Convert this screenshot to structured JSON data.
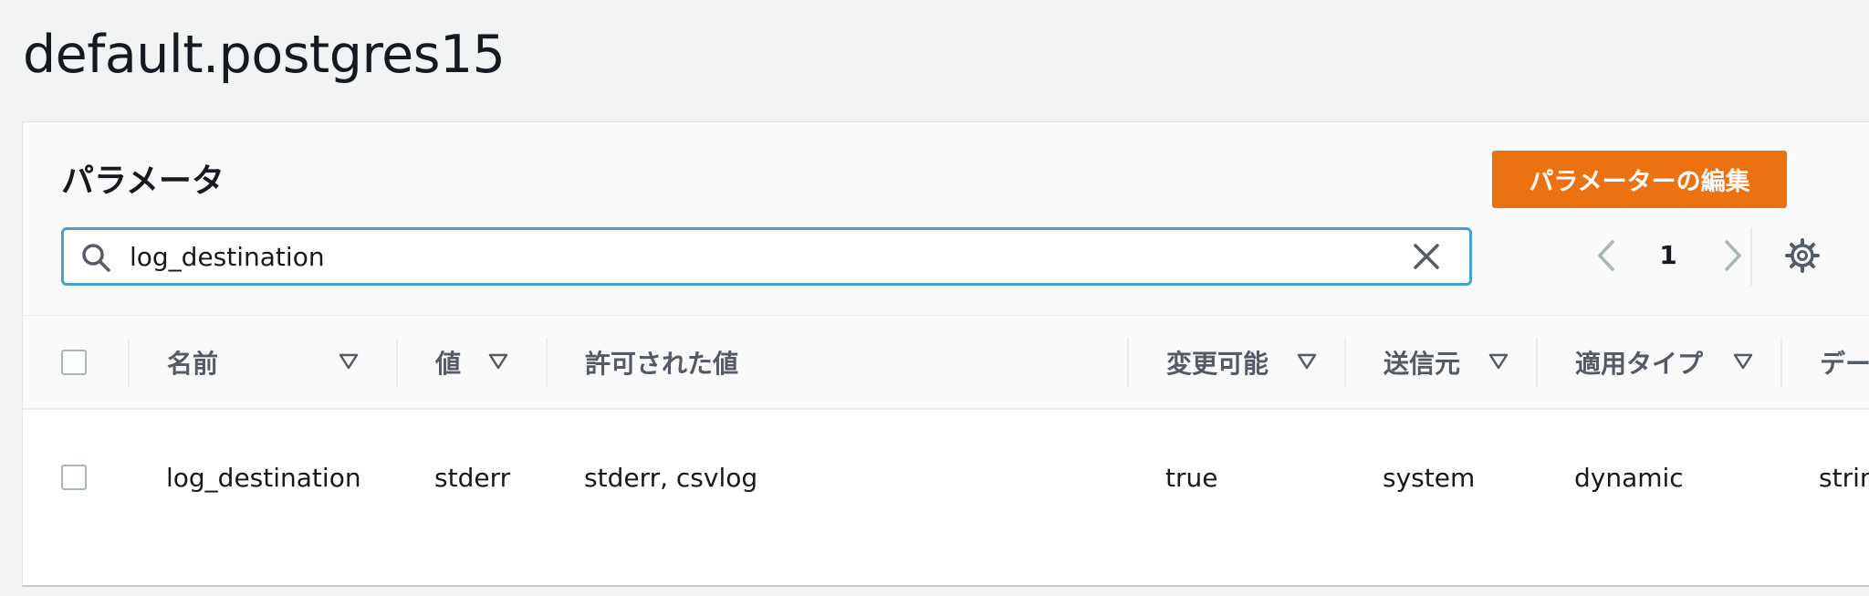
{
  "page": {
    "title": "default.postgres15"
  },
  "panel": {
    "title": "パラメータ",
    "edit_button_label": "パラメーターの編集"
  },
  "search": {
    "value": "log_destination",
    "icon": "search-icon",
    "clear_icon": "close-icon"
  },
  "pagination": {
    "current_page": "1",
    "prev_icon": "chevron-left-icon",
    "next_icon": "chevron-right-icon",
    "settings_icon": "gear-icon"
  },
  "table": {
    "columns": [
      {
        "label": "名前",
        "sortable": true
      },
      {
        "label": "値",
        "sortable": true
      },
      {
        "label": "許可された値",
        "sortable": false
      },
      {
        "label": "変更可能",
        "sortable": true
      },
      {
        "label": "送信元",
        "sortable": true
      },
      {
        "label": "適用タイプ",
        "sortable": true
      },
      {
        "label": "デー",
        "sortable": false
      }
    ],
    "rows": [
      {
        "name": "log_destination",
        "value": "stderr",
        "allowed_values": "stderr, csvlog",
        "modifiable": "true",
        "source": "system",
        "apply_type": "dynamic",
        "data_type": "strin"
      }
    ]
  },
  "colors": {
    "accent": "#ec7211",
    "focus": "#44a0cd",
    "background": "#f2f3f3"
  }
}
